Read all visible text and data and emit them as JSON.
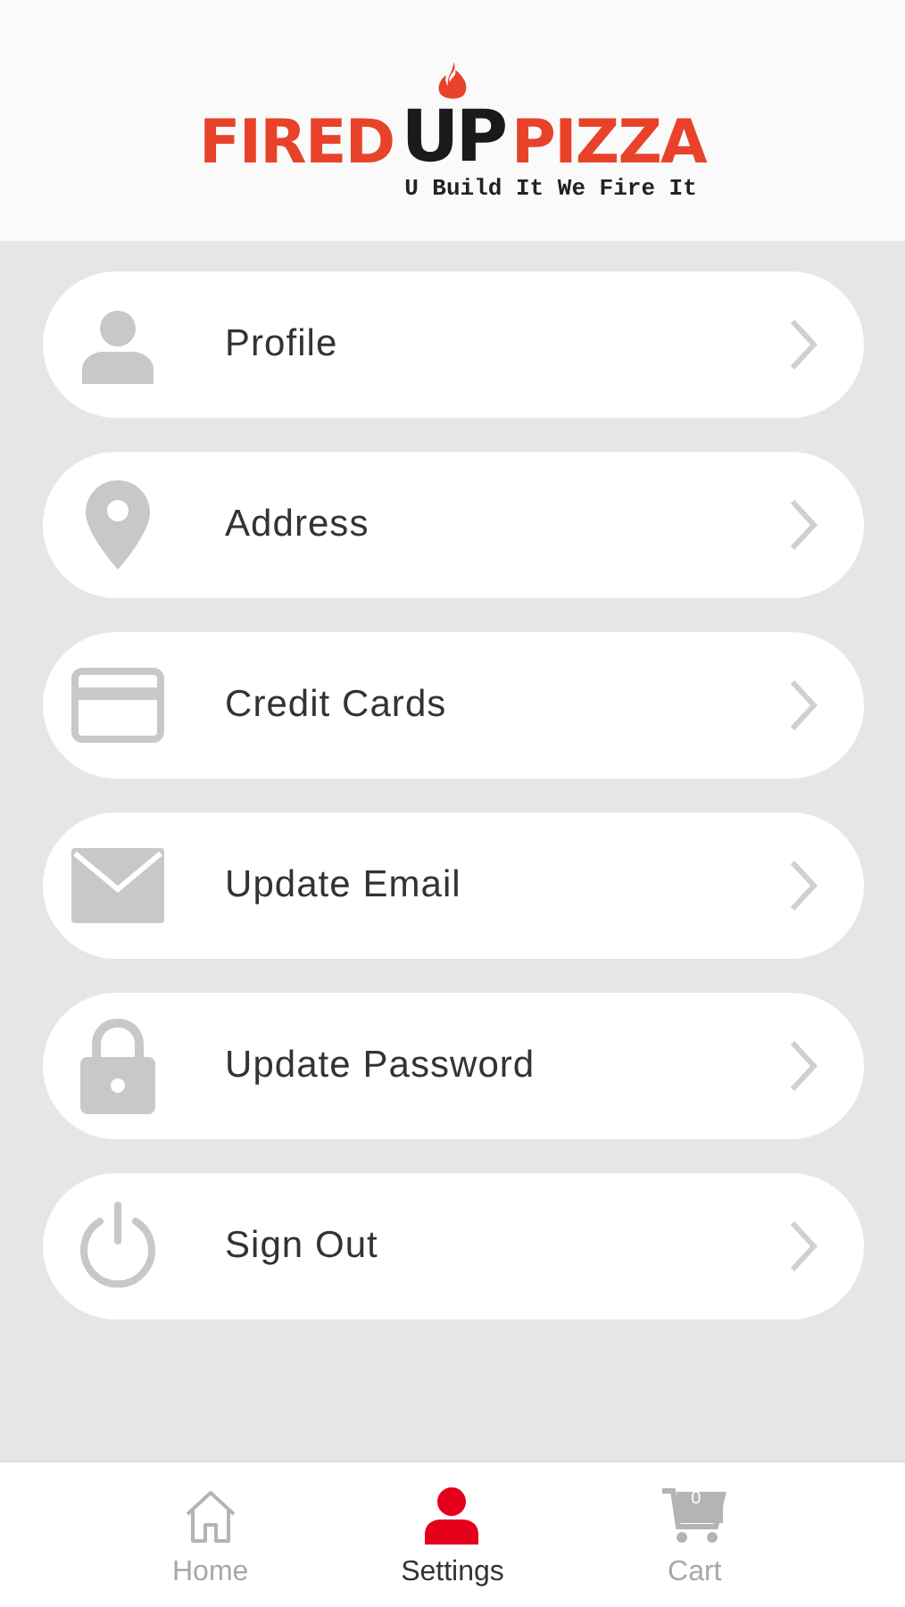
{
  "logo": {
    "word_1": "FIRED",
    "word_2": "UP",
    "word_3": "PIZZA",
    "tagline": "U Build It We Fire It"
  },
  "menu": [
    {
      "kind": "person",
      "label": "Profile"
    },
    {
      "kind": "pin",
      "label": "Address"
    },
    {
      "kind": "card",
      "label": "Credit Cards"
    },
    {
      "kind": "mail",
      "label": "Update Email"
    },
    {
      "kind": "lock",
      "label": "Update Password"
    },
    {
      "kind": "power",
      "label": "Sign Out"
    }
  ],
  "tab_bar": [
    {
      "kind": "home",
      "label": "Home",
      "selected": false
    },
    {
      "kind": "person",
      "label": "Settings",
      "selected": true
    },
    {
      "kind": "cart",
      "label": "Cart",
      "selected": false,
      "badge": "0"
    }
  ]
}
